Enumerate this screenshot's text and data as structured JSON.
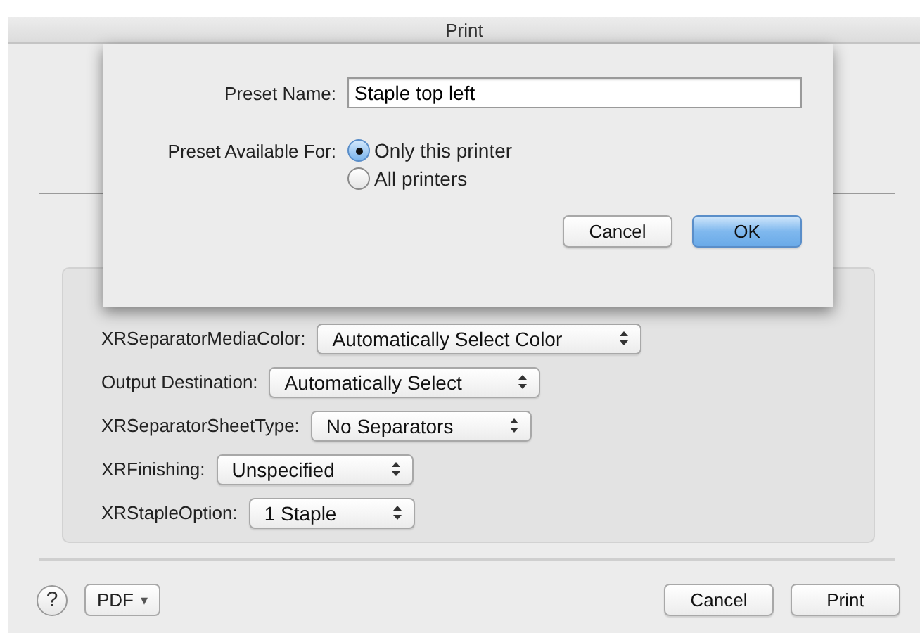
{
  "window": {
    "title": "Print"
  },
  "sheet": {
    "preset_name": {
      "label": "Preset Name:",
      "value": "Staple top left"
    },
    "available_for": {
      "label": "Preset Available For:",
      "options": [
        {
          "label": "Only this printer",
          "selected": true
        },
        {
          "label": "All printers",
          "selected": false
        }
      ]
    },
    "buttons": [
      {
        "label": "Cancel",
        "default": false
      },
      {
        "label": "OK",
        "default": true
      }
    ]
  },
  "options": [
    {
      "label": "XRSeparatorMediaColor:",
      "value": "Automatically Select Color"
    },
    {
      "label": "Output Destination:",
      "value": "Automatically Select"
    },
    {
      "label": "XRSeparatorSheetType:",
      "value": "No Separators"
    },
    {
      "label": "XRFinishing:",
      "value": "Unspecified"
    },
    {
      "label": "XRStapleOption:",
      "value": "1 Staple"
    }
  ],
  "footer": {
    "help": "?",
    "pdf": {
      "label": "PDF",
      "caret": "▾"
    },
    "buttons": [
      {
        "label": "Cancel",
        "default": false
      },
      {
        "label": "Print",
        "default": false
      }
    ]
  }
}
